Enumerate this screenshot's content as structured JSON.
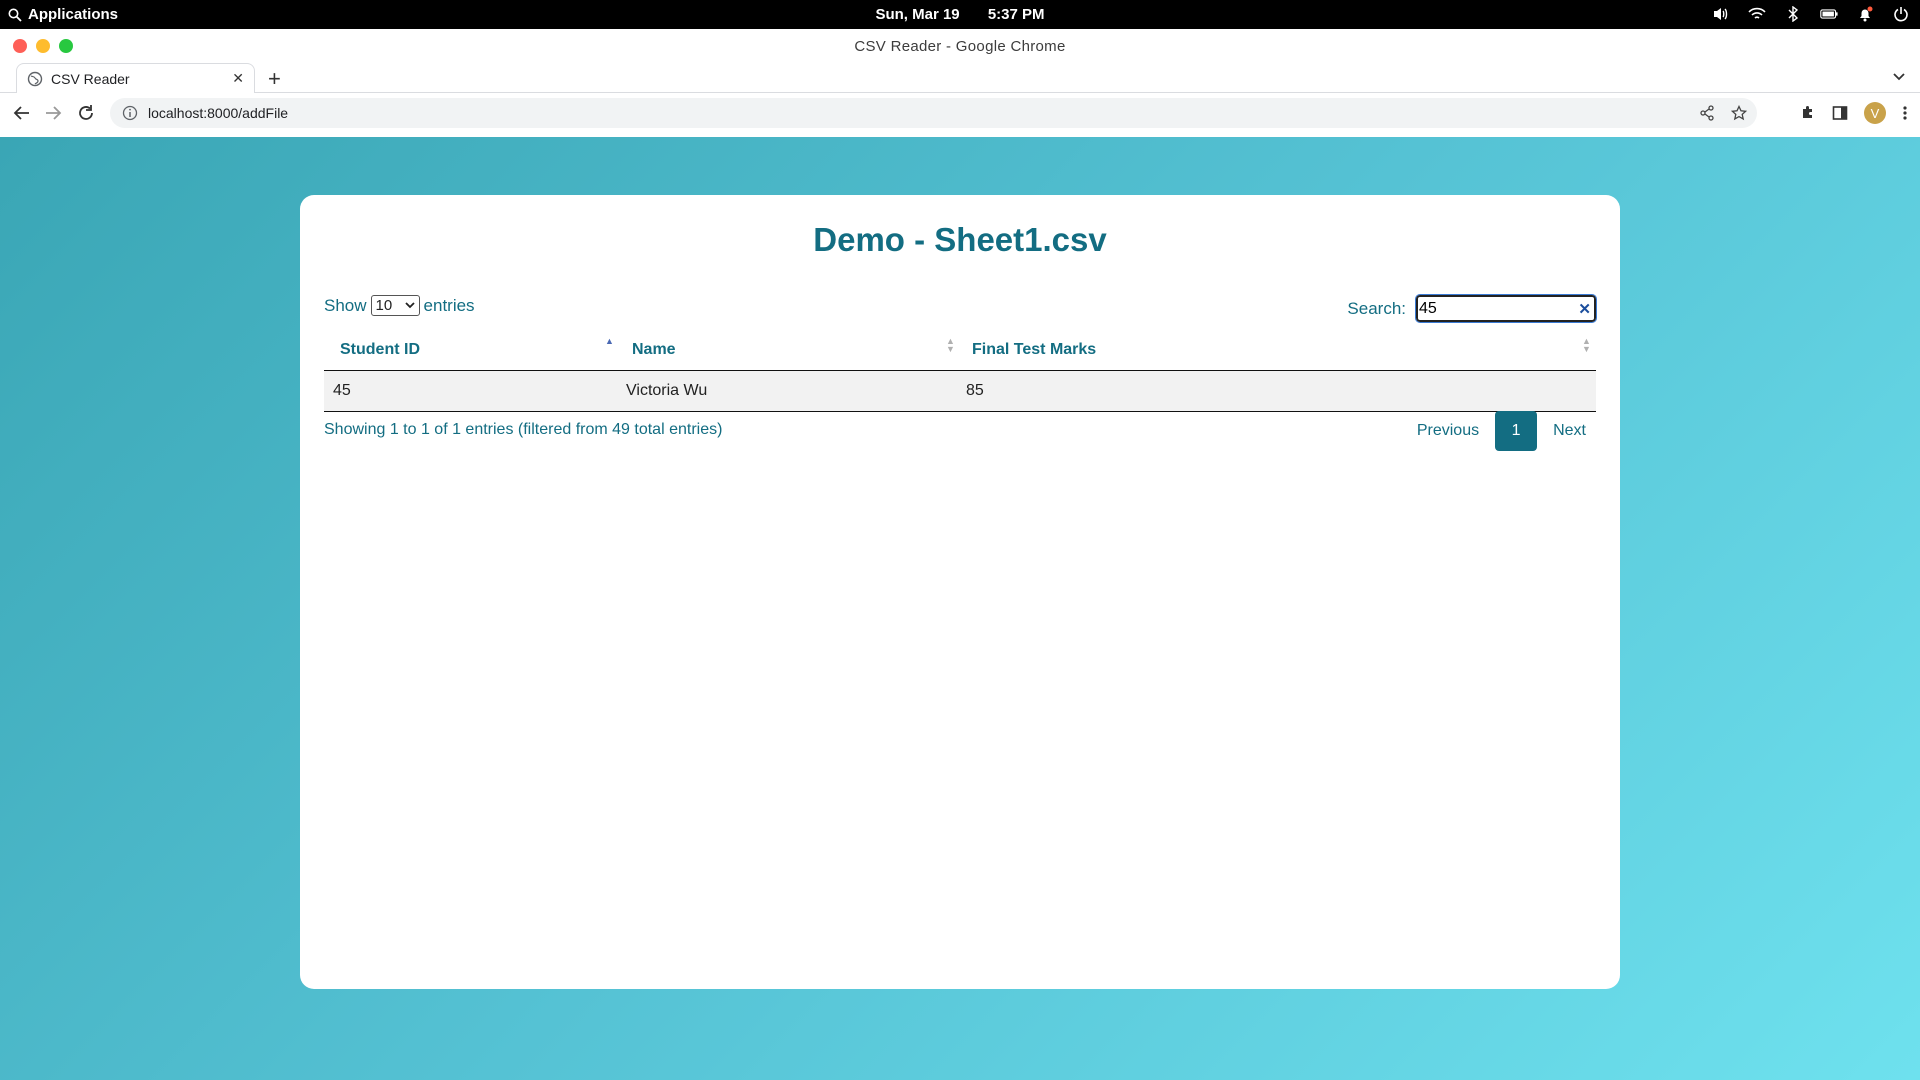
{
  "os": {
    "apps_label": "Applications",
    "date": "Sun, Mar 19",
    "time": "5:37 PM"
  },
  "browser": {
    "window_title": "CSV Reader - Google Chrome",
    "tab_title": "CSV Reader",
    "url": "localhost:8000/addFile",
    "avatar_letter": "V"
  },
  "page": {
    "title": "Demo - Sheet1.csv",
    "length": {
      "show_label": "Show",
      "selected": "10",
      "entries_label": "entries"
    },
    "search": {
      "label": "Search:",
      "value": "45"
    },
    "table": {
      "columns": [
        "Student ID",
        "Name",
        "Final Test Marks"
      ],
      "rows": [
        [
          "45",
          "Victoria Wu",
          "85"
        ]
      ]
    },
    "info": "Showing 1 to 1 of 1 entries (filtered from 49 total entries)",
    "pagination": {
      "previous": "Previous",
      "current": "1",
      "next": "Next"
    }
  },
  "colors": {
    "accent": "#136d82",
    "gradient_start": "#3aa6b5",
    "gradient_end": "#6ee1ee"
  }
}
